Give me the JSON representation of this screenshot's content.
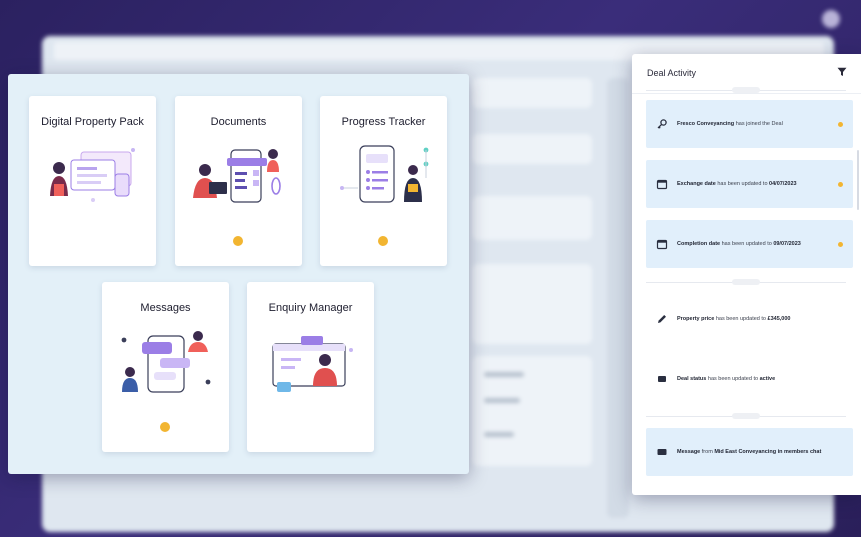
{
  "modules": [
    {
      "title": "Digital Property Pack",
      "illustration": "property-pack-illustration",
      "notification": false
    },
    {
      "title": "Documents",
      "illustration": "documents-illustration",
      "notification": true
    },
    {
      "title": "Progress Tracker",
      "illustration": "progress-tracker-illustration",
      "notification": true
    },
    {
      "title": "Messages",
      "illustration": "messages-illustration",
      "notification": true
    },
    {
      "title": "Enquiry Manager",
      "illustration": "enquiry-manager-illustration",
      "notification": false
    }
  ],
  "deal_activity": {
    "title": "Deal Activity",
    "items": [
      {
        "icon": "key-icon",
        "bold": "Fresco Conveyancing",
        "text": " has joined the Deal",
        "extra": "",
        "highlight": true,
        "new": true
      },
      {
        "icon": "calendar-icon",
        "bold": "Exchange date",
        "text": " has been updated to ",
        "extra": "04/07/2023",
        "highlight": true,
        "new": true
      },
      {
        "icon": "calendar-icon",
        "bold": "Completion date",
        "text": " has been updated to ",
        "extra": "09/07/2023",
        "highlight": true,
        "new": true
      },
      {
        "icon": "pencil-icon",
        "bold": "Property price",
        "text": " has been updated to ",
        "extra": "£345,000",
        "highlight": false,
        "new": false
      },
      {
        "icon": "tag-icon",
        "bold": "Deal status",
        "text": " has been updated to ",
        "extra": "active",
        "highlight": false,
        "new": false
      },
      {
        "icon": "message-icon",
        "bold": "Message",
        "text": " from ",
        "extra": "Mid East Conveyancing in members chat",
        "highlight": true,
        "new": false
      }
    ]
  },
  "colors": {
    "accent": "#f2b531",
    "purple": "#7b5ce0",
    "highlight": "#e1effb",
    "panel": "#e3f0f8"
  }
}
